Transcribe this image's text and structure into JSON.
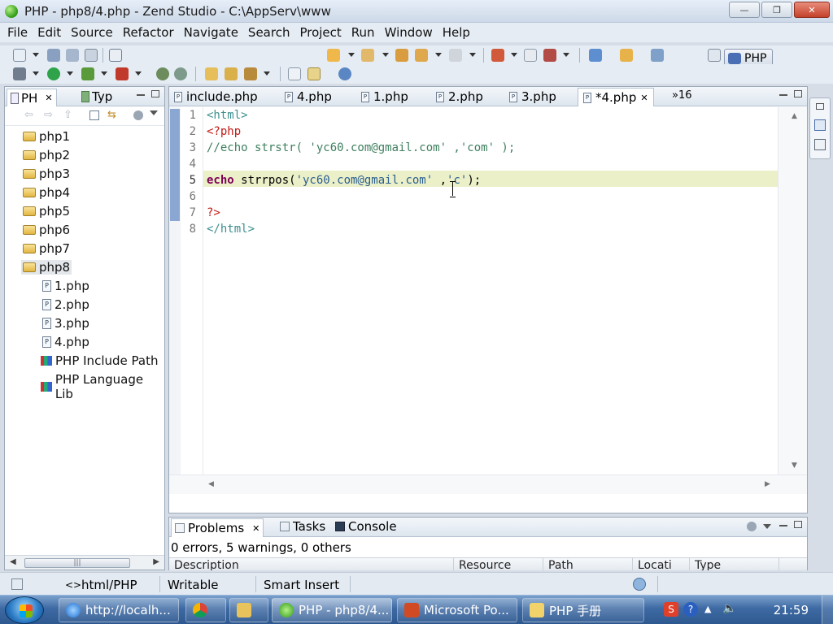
{
  "window": {
    "title": "PHP - php8/4.php - Zend Studio - C:\\AppServ\\www",
    "minimize": "—",
    "restore": "❐",
    "close": "✕"
  },
  "menu": [
    "File",
    "Edit",
    "Source",
    "Refactor",
    "Navigate",
    "Search",
    "Project",
    "Run",
    "Window",
    "Help"
  ],
  "perspective": {
    "label": "PHP"
  },
  "left_panel": {
    "tab_active": "PH",
    "tab_other": "Typ",
    "projects": [
      "php1",
      "php2",
      "php3",
      "php4",
      "php5",
      "php6",
      "php7",
      "php8"
    ],
    "php8_children": [
      "1.php",
      "2.php",
      "3.php",
      "4.php"
    ],
    "libraries": [
      "PHP Include Path",
      "PHP Language Lib"
    ],
    "scroll_grip": "|||"
  },
  "editor": {
    "tabs": [
      "include.php",
      "4.php",
      "1.php",
      "2.php",
      "3.php",
      "*4.php"
    ],
    "overflow": "»16",
    "line_numbers": [
      "1",
      "2",
      "3",
      "4",
      "5",
      "6",
      "7",
      "8"
    ],
    "lines": {
      "l1": "<html>",
      "l2": "<?php",
      "l3": "//echo strstr( 'yc60.com@gmail.com' ,'com' );",
      "l5_kw": "echo",
      "l5_fn": " strrpos(",
      "l5_s1": "'yc60.com@gmail.com'",
      "l5_mid": " ,",
      "l5_s2": "'c'",
      "l5_end": ");",
      "l7": "?>",
      "l8": "</html>"
    }
  },
  "bottom_panel": {
    "tabs": [
      "Problems",
      "Tasks",
      "Console"
    ],
    "summary": "0 errors, 5 warnings, 0 others",
    "columns": [
      "Description",
      "Resource",
      "Path",
      "Locati",
      "Type"
    ]
  },
  "statusbar": {
    "content_type": "html/PHP",
    "writable": "Writable",
    "insert_mode": "Smart Insert"
  },
  "taskbar": {
    "buttons": [
      "http://localh...",
      "",
      "",
      "PHP - php8/4...",
      "Microsoft Po...",
      "PHP 手册"
    ],
    "clock": "21:59"
  }
}
